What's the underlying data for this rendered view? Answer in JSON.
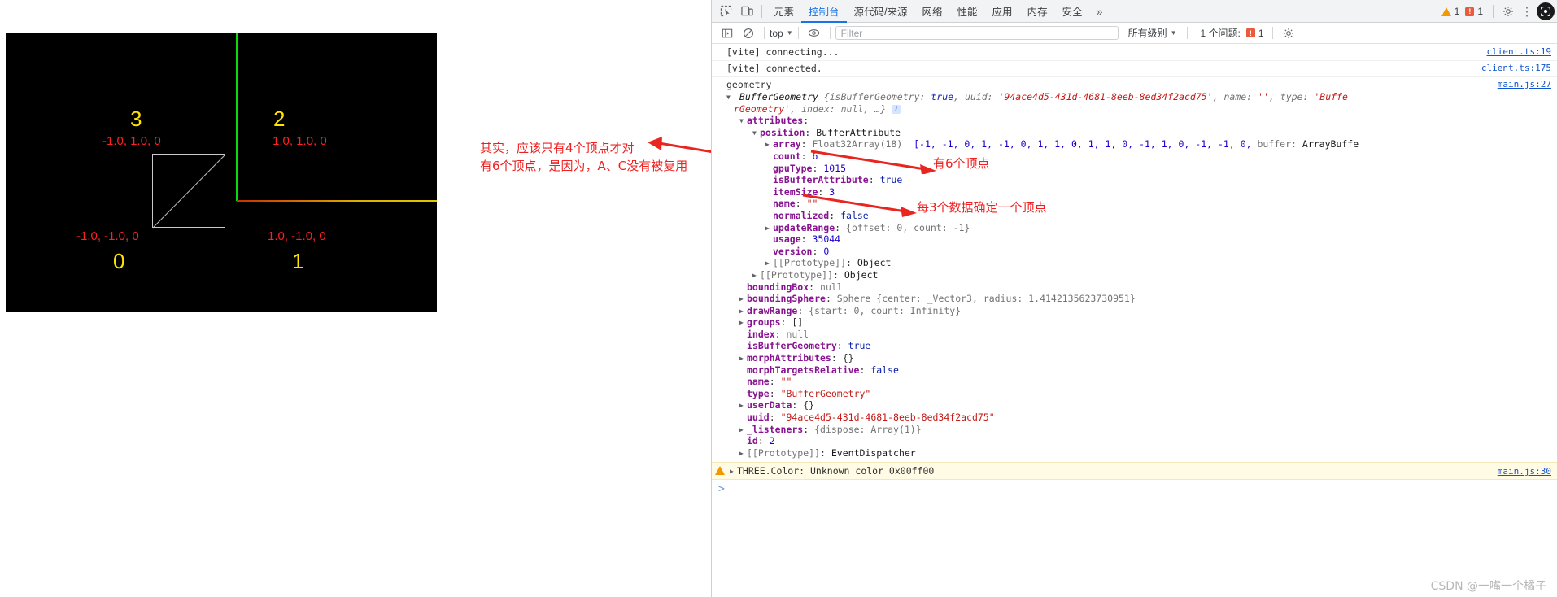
{
  "viewport": {
    "name": "three-js-render-canvas",
    "background": "#000000",
    "axis_y_color": "#0bd90b",
    "axis_x_color": "#dcae00",
    "vertex_labels": [
      {
        "index": "0",
        "coords": "-1.0, -1.0, 0"
      },
      {
        "index": "1",
        "coords": "1.0, -1.0, 0"
      },
      {
        "index": "2",
        "coords": "1.0, 1.0, 0"
      },
      {
        "index": "3",
        "coords": "-1.0, 1.0, 0"
      }
    ],
    "label_color": "#ffe400",
    "coord_color": "#ff2020"
  },
  "annotations": {
    "middle_note_line1": "其实，应该只有4个顶点才对",
    "middle_note_line2": "有6个顶点，是因为，A、C没有被复用",
    "note_count": "有6个顶点",
    "note_itemsize": "每3个数据确定一个顶点",
    "color": "#f02020"
  },
  "devtools": {
    "tabs": [
      {
        "label": "元素",
        "active": false
      },
      {
        "label": "控制台",
        "active": true
      },
      {
        "label": "源代码/来源",
        "active": false
      },
      {
        "label": "网络",
        "active": false
      },
      {
        "label": "性能",
        "active": false
      },
      {
        "label": "应用",
        "active": false
      },
      {
        "label": "内存",
        "active": false
      },
      {
        "label": "安全",
        "active": false
      }
    ],
    "more_label": "»",
    "warning_count": "1",
    "error_count": "1",
    "icons": {
      "inspect": "inspect-element-icon",
      "device": "device-toolbar-icon",
      "gear": "settings-gear-icon",
      "kebab": "more-options-icon",
      "close": "close-devtools-icon"
    },
    "filterbar": {
      "sidebar_toggle": "console-sidebar-icon",
      "clear": "clear-console-icon",
      "context": "top",
      "eye": "live-expression-icon",
      "filter_placeholder": "Filter",
      "levels": "所有级别",
      "issues_label": "1 个问题:",
      "issues_count": "1",
      "settings": "console-settings-icon"
    },
    "console": {
      "messages": [
        {
          "text": "[vite] connecting...",
          "source": "client.ts:19"
        },
        {
          "text": "[vite] connected.",
          "source": "client.ts:175"
        }
      ],
      "geometry_label": "geometry",
      "geometry_source": "main.js:27",
      "object": {
        "header_class": "_BufferGeometry",
        "header_preview_1": "{isBufferGeometry:",
        "header_true": "true",
        "header_uuid_key": "uuid:",
        "header_uuid_val": "'94ace4d5-431d-4681-8eeb-8ed34f2acd75'",
        "header_name_key": "name:",
        "header_name_val": "''",
        "header_type_key": "type:",
        "header_type_val": "'Buffe",
        "header_line2_a": "rGeometry'",
        "header_line2_b": "index:",
        "header_line2_c": "null,",
        "header_line2_d": "…}",
        "attributes": "attributes",
        "position_key": "position",
        "position_val": "BufferAttribute",
        "array_key": "array",
        "array_type": "Float32Array(18)",
        "array_values": "[-1, -1, 0, 1, -1, 0, 1, 1, 0, 1, 1, 0, -1, 1, 0, -1, -1, 0,",
        "array_buffer_key": "buffer:",
        "array_buffer_val": "ArrayBuffe",
        "count_key": "count",
        "count_val": "6",
        "gpuType_key": "gpuType",
        "gpuType_val": "1015",
        "isBufferAttribute_key": "isBufferAttribute",
        "isBufferAttribute_val": "true",
        "itemSize_key": "itemSize",
        "itemSize_val": "3",
        "name_key": "name",
        "name_val": "\"\"",
        "normalized_key": "normalized",
        "normalized_val": "false",
        "updateRange_key": "updateRange",
        "updateRange_val": "{offset: 0, count: -1}",
        "usage_key": "usage",
        "usage_val": "35044",
        "version_key": "version",
        "version_val": "0",
        "proto1": "[[Prototype]]",
        "proto1_val": "Object",
        "proto2": "[[Prototype]]",
        "proto2_val": "Object",
        "boundingBox_key": "boundingBox",
        "boundingBox_val": "null",
        "boundingSphere_key": "boundingSphere",
        "boundingSphere_cls": "Sphere",
        "boundingSphere_val": "{center: _Vector3, radius: 1.4142135623730951}",
        "drawRange_key": "drawRange",
        "drawRange_val": "{start: 0, count: Infinity}",
        "groups_key": "groups",
        "groups_val": "[]",
        "index_key": "index",
        "index_val": "null",
        "isBufferGeometry_key": "isBufferGeometry",
        "isBufferGeometry_val": "true",
        "morphAttributes_key": "morphAttributes",
        "morphAttributes_val": "{}",
        "morphTargetsRelative_key": "morphTargetsRelative",
        "morphTargetsRelative_val": "false",
        "name2_key": "name",
        "name2_val": "\"\"",
        "type_key": "type",
        "type_val": "\"BufferGeometry\"",
        "userData_key": "userData",
        "userData_val": "{}",
        "uuid_key": "uuid",
        "uuid_val": "\"94ace4d5-431d-4681-8eeb-8ed34f2acd75\"",
        "listeners_key": "_listeners",
        "listeners_val": "{dispose: Array(1)}",
        "id_key": "id",
        "id_val": "2",
        "proto3": "[[Prototype]]",
        "proto3_val": "EventDispatcher"
      },
      "warning": {
        "text": "THREE.Color: Unknown color 0x00ff00",
        "source": "main.js:30"
      },
      "prompt": ">"
    }
  },
  "watermark": "CSDN @一嘴一个橘子"
}
